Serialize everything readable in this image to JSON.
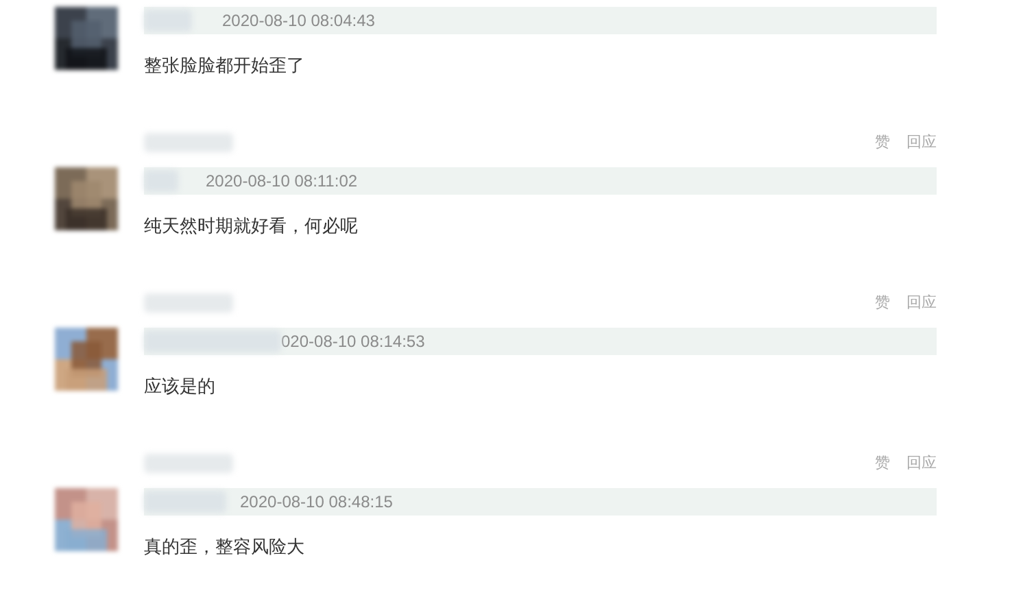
{
  "comments": [
    {
      "time": "2020-08-10 08:04:43",
      "text": "整张脸脸都开始歪了"
    },
    {
      "actions": [
        "赞",
        "回应"
      ],
      "time": "2020-08-10 08:11:02",
      "text": "纯天然时期就好看，何必呢"
    },
    {
      "actions": [
        "赞",
        "回应"
      ],
      "time": "020-08-10 08:14:53",
      "text": "应该是的"
    },
    {
      "actions": [
        "赞",
        "回应"
      ],
      "time": "2020-08-10 08:48:15",
      "text": "真的歪，整容风险大"
    }
  ]
}
